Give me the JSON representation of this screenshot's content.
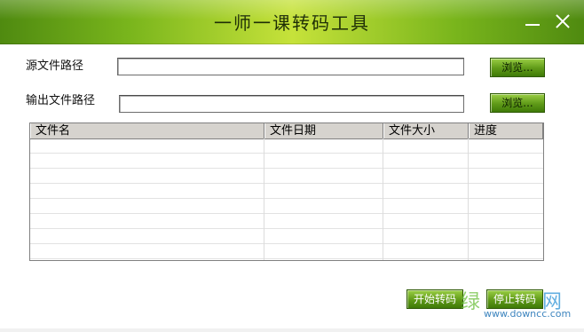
{
  "window": {
    "title": "一师一课转码工具",
    "minimize_icon": "minimize-icon",
    "close_icon": "close-icon",
    "accent_color": "#79b51c"
  },
  "form": {
    "source_label": "源文件路径",
    "source_value": "",
    "output_label": "输出文件路径",
    "output_value": "",
    "browse_source": "浏览...",
    "browse_output": "浏览..."
  },
  "table": {
    "columns": [
      "文件名",
      "文件日期",
      "文件大小",
      "进度"
    ],
    "rows": []
  },
  "actions": {
    "start": "开始转码",
    "stop": "停止转码"
  },
  "watermark": {
    "text_a": "绿",
    "text_b": "网",
    "url": "www.downcc.com"
  }
}
